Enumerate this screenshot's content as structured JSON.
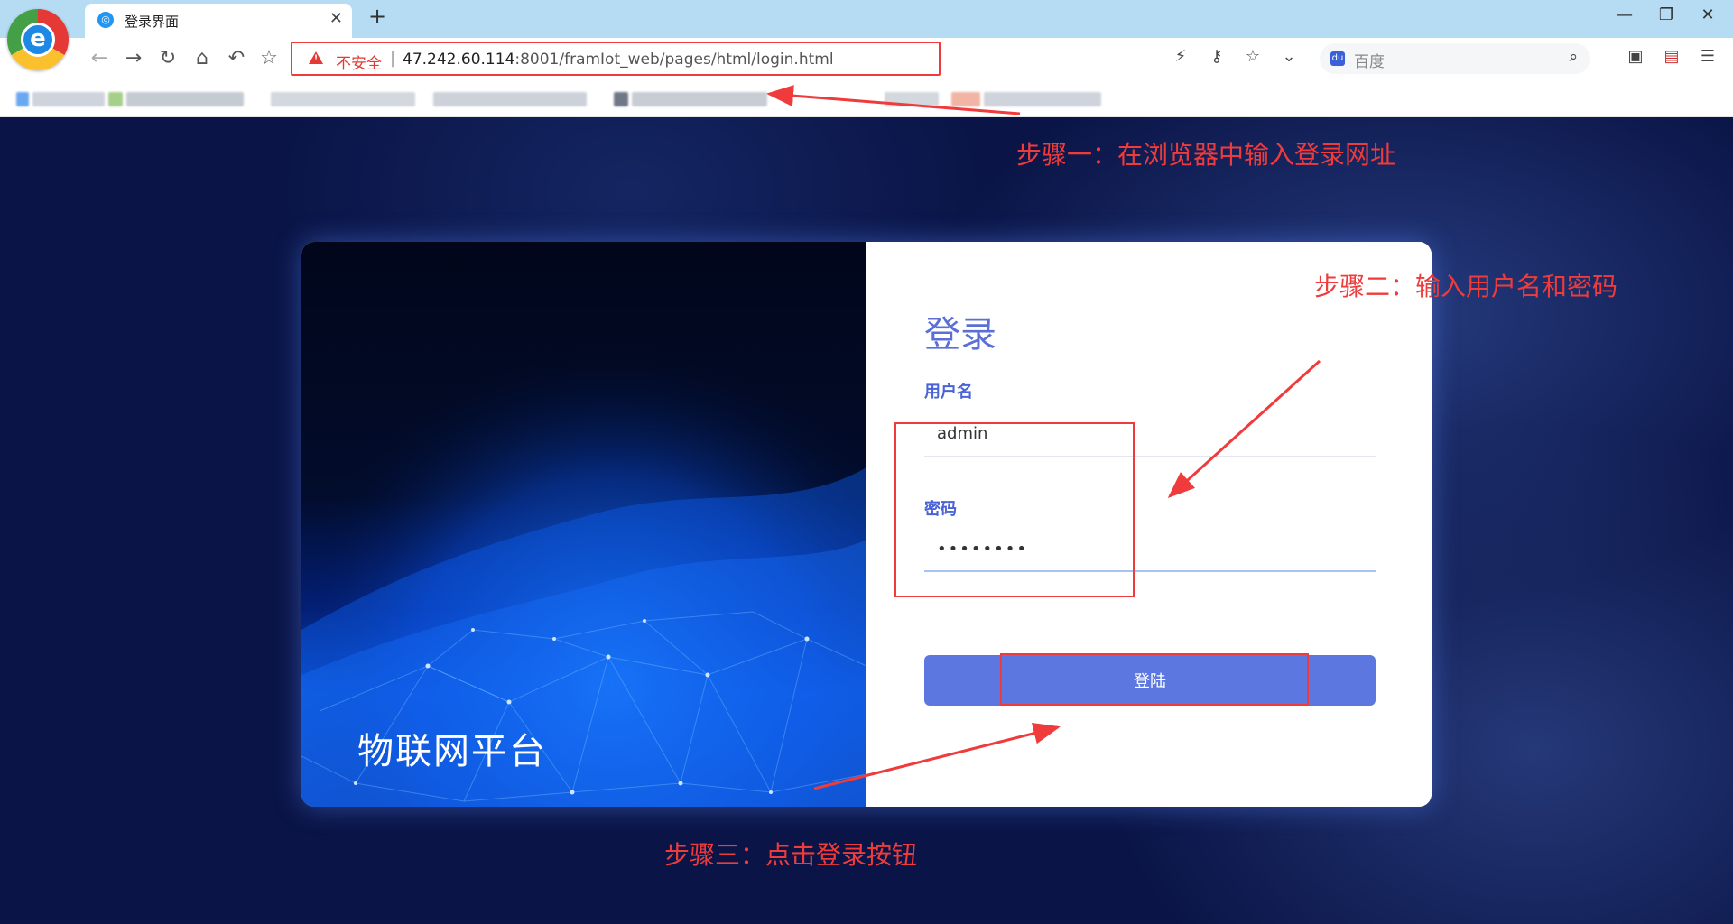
{
  "browser": {
    "tab_title": "登录界面",
    "new_tab_glyph": "+",
    "address": {
      "insecure_label": "不安全",
      "separator": "|",
      "url_host": "47.242.60.114",
      "url_rest": ":8001/framIot_web/pages/html/login.html"
    },
    "search_placeholder": "百度",
    "icons": [
      "back-icon",
      "forward-icon",
      "reload-icon",
      "home-icon",
      "undo-icon",
      "star-icon",
      "lightning-icon",
      "key-icon",
      "bookmark-star-icon",
      "chevron-down-icon",
      "search-icon",
      "extension-icon",
      "pdf-icon",
      "menu-icon"
    ]
  },
  "login": {
    "platform_name": "物联网平台",
    "title": "登录",
    "username_label": "用户名",
    "username_value": "admin",
    "password_label": "密码",
    "password_value": "••••••••",
    "button_label": "登陆"
  },
  "annotations": {
    "step1": "步骤一：在浏览器中输入登录网址",
    "step2": "步骤二：输入用户名和密码",
    "step3": "步骤三：点击登录按钮"
  },
  "colors": {
    "accent": "#5c77e0",
    "annotation": "#ef3b3b",
    "background": "#0a1446"
  }
}
